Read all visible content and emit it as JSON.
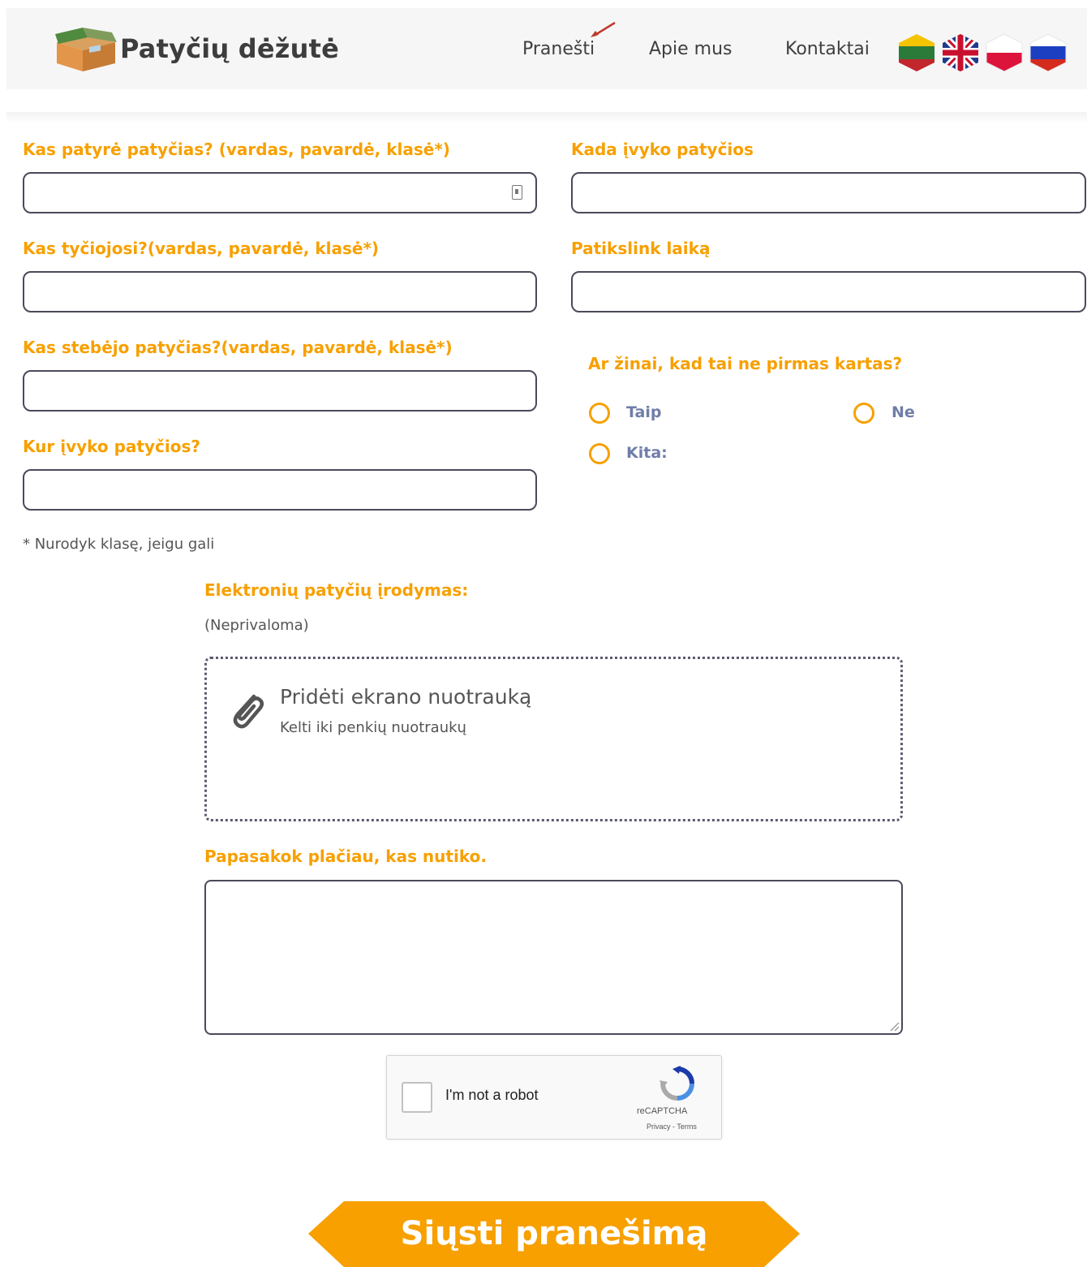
{
  "header": {
    "site_title": "Patyčių dėžutė",
    "nav": [
      {
        "label": "Pranešti"
      },
      {
        "label": "Apie mus"
      },
      {
        "label": "Kontaktai"
      }
    ],
    "languages": [
      "lithuanian-flag",
      "uk-flag",
      "polish-flag",
      "russian-flag"
    ]
  },
  "form": {
    "victim_label": "Kas patyrė patyčias? (vardas, pavardė, klasė*)",
    "victim_value": "",
    "when_label": "Kada įvyko patyčios",
    "when_value": "",
    "bully_label": "Kas tyčiojosi?(vardas, pavardė, klasė*)",
    "bully_value": "",
    "time_label": "Patikslink laiką",
    "time_value": "",
    "witness_label": "Kas stebėjo patyčias?(vardas, pavardė, klasė*)",
    "witness_value": "",
    "place_label": "Kur įvyko patyčios?",
    "place_value": "",
    "repeat_question": "Ar žinai, kad tai ne pirmas kartas?",
    "repeat_options": [
      "Taip",
      "Ne",
      "Kita:"
    ],
    "class_note": "* Nurodyk klasę, jeigu gali",
    "evidence_label": "Elektronių patyčių įrodymas:",
    "evidence_optional": "(Neprivaloma)",
    "upload_title": "Pridėti ekrano nuotrauką",
    "upload_subtitle": "Kelti iki penkių nuotraukų",
    "details_label": "Papasakok plačiau, kas nutiko.",
    "details_value": ""
  },
  "captcha": {
    "text": "I'm not a robot",
    "brand": "reCAPTCHA",
    "links": "Privacy - Terms"
  },
  "submit": {
    "label": "Siųsti pranešimą"
  },
  "colors": {
    "accent": "#f7a000",
    "radio_label": "#6f7da8",
    "border": "#4a4a5a"
  }
}
